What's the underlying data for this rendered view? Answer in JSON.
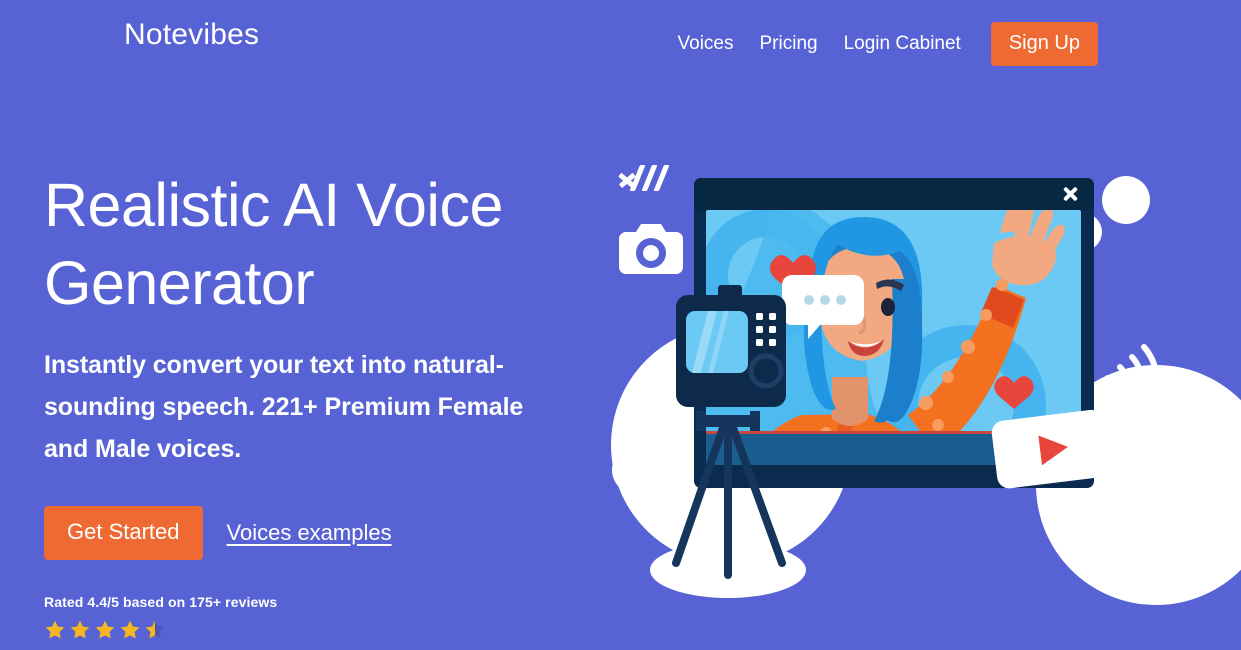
{
  "theme": {
    "background": "#5763D4",
    "accent_orange": "#EF6A33",
    "text_white": "#FFFFFF",
    "star_gold": "#F5B721",
    "star_empty": "#4B55B8"
  },
  "header": {
    "brand": "Notevibes",
    "nav": [
      {
        "label": "Voices"
      },
      {
        "label": "Pricing"
      },
      {
        "label": "Login Cabinet"
      }
    ],
    "signup_label": "Sign Up"
  },
  "hero": {
    "headline": "Realistic AI Voice Generator",
    "subhead": "Instantly convert your text into natural-sounding speech. 221+ Premium Female and Male voices.",
    "primary_cta": "Get Started",
    "secondary_cta": "Voices examples",
    "rating_text": "Rated 4.4/5 based on 175+ reviews",
    "rating_value": "4.4",
    "rating_max": "5",
    "review_count": "175+",
    "stars_full": 4,
    "stars_half": 1
  },
  "illustration": {
    "alt": "Woman with blue hair waving inside a video player window, video camera on tripod",
    "colors": {
      "screen_frame": "#0B2B4E",
      "screen_bg": "#5BC2F0",
      "screen_bg_dark": "#29A8E8",
      "control_bar": "#1A5E8F",
      "skin": "#F2A982",
      "hair": "#2196E3",
      "hair_dark": "#1B7FCB",
      "shirt": "#F4711F",
      "shirt_dots": "#F79B5E",
      "heart": "#E8453C",
      "white": "#FFFFFF",
      "camera_body": "#0E2A4A"
    }
  }
}
